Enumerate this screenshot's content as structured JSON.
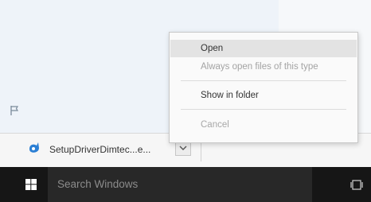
{
  "download": {
    "file_name": "SetupDriverDimtec...e..."
  },
  "context_menu": {
    "open_label": "Open",
    "always_open_label": "Always open files of this type",
    "show_in_folder_label": "Show in folder",
    "cancel_label": "Cancel"
  },
  "taskbar": {
    "search_placeholder": "Search Windows"
  },
  "icons": {
    "file": "setup-file-icon",
    "chevron": "chevron-down-icon",
    "flag": "flag-icon",
    "windows": "windows-logo-icon",
    "task_view": "task-view-icon"
  },
  "colors": {
    "menu_highlight": "#e3e3e3",
    "taskbar_bg": "#161616",
    "search_bg": "#282828",
    "file_icon_blue": "#2b7fd4"
  }
}
